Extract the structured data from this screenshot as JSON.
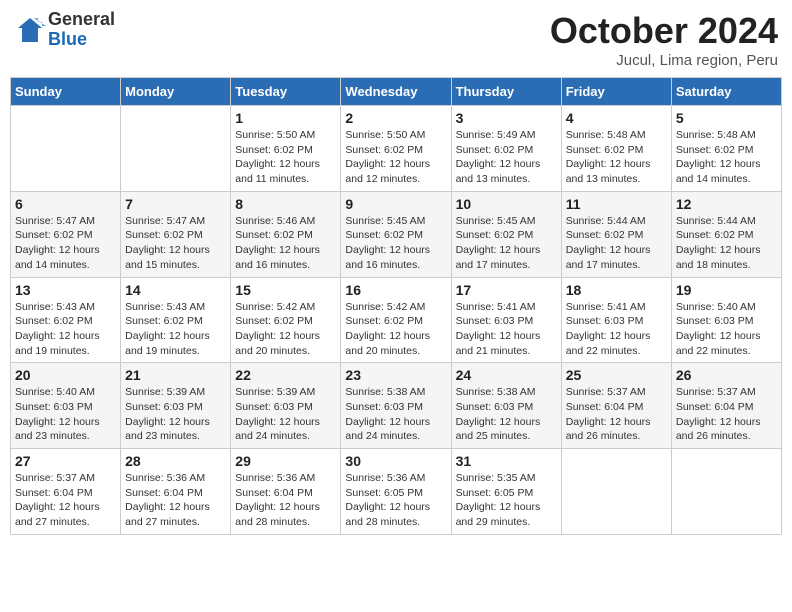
{
  "header": {
    "logo_general": "General",
    "logo_blue": "Blue",
    "month_title": "October 2024",
    "location": "Jucul, Lima region, Peru"
  },
  "weekdays": [
    "Sunday",
    "Monday",
    "Tuesday",
    "Wednesday",
    "Thursday",
    "Friday",
    "Saturday"
  ],
  "weeks": [
    [
      {
        "day": "",
        "sunrise": "",
        "sunset": "",
        "daylight": ""
      },
      {
        "day": "",
        "sunrise": "",
        "sunset": "",
        "daylight": ""
      },
      {
        "day": "1",
        "sunrise": "Sunrise: 5:50 AM",
        "sunset": "Sunset: 6:02 PM",
        "daylight": "Daylight: 12 hours and 11 minutes."
      },
      {
        "day": "2",
        "sunrise": "Sunrise: 5:50 AM",
        "sunset": "Sunset: 6:02 PM",
        "daylight": "Daylight: 12 hours and 12 minutes."
      },
      {
        "day": "3",
        "sunrise": "Sunrise: 5:49 AM",
        "sunset": "Sunset: 6:02 PM",
        "daylight": "Daylight: 12 hours and 13 minutes."
      },
      {
        "day": "4",
        "sunrise": "Sunrise: 5:48 AM",
        "sunset": "Sunset: 6:02 PM",
        "daylight": "Daylight: 12 hours and 13 minutes."
      },
      {
        "day": "5",
        "sunrise": "Sunrise: 5:48 AM",
        "sunset": "Sunset: 6:02 PM",
        "daylight": "Daylight: 12 hours and 14 minutes."
      }
    ],
    [
      {
        "day": "6",
        "sunrise": "Sunrise: 5:47 AM",
        "sunset": "Sunset: 6:02 PM",
        "daylight": "Daylight: 12 hours and 14 minutes."
      },
      {
        "day": "7",
        "sunrise": "Sunrise: 5:47 AM",
        "sunset": "Sunset: 6:02 PM",
        "daylight": "Daylight: 12 hours and 15 minutes."
      },
      {
        "day": "8",
        "sunrise": "Sunrise: 5:46 AM",
        "sunset": "Sunset: 6:02 PM",
        "daylight": "Daylight: 12 hours and 16 minutes."
      },
      {
        "day": "9",
        "sunrise": "Sunrise: 5:45 AM",
        "sunset": "Sunset: 6:02 PM",
        "daylight": "Daylight: 12 hours and 16 minutes."
      },
      {
        "day": "10",
        "sunrise": "Sunrise: 5:45 AM",
        "sunset": "Sunset: 6:02 PM",
        "daylight": "Daylight: 12 hours and 17 minutes."
      },
      {
        "day": "11",
        "sunrise": "Sunrise: 5:44 AM",
        "sunset": "Sunset: 6:02 PM",
        "daylight": "Daylight: 12 hours and 17 minutes."
      },
      {
        "day": "12",
        "sunrise": "Sunrise: 5:44 AM",
        "sunset": "Sunset: 6:02 PM",
        "daylight": "Daylight: 12 hours and 18 minutes."
      }
    ],
    [
      {
        "day": "13",
        "sunrise": "Sunrise: 5:43 AM",
        "sunset": "Sunset: 6:02 PM",
        "daylight": "Daylight: 12 hours and 19 minutes."
      },
      {
        "day": "14",
        "sunrise": "Sunrise: 5:43 AM",
        "sunset": "Sunset: 6:02 PM",
        "daylight": "Daylight: 12 hours and 19 minutes."
      },
      {
        "day": "15",
        "sunrise": "Sunrise: 5:42 AM",
        "sunset": "Sunset: 6:02 PM",
        "daylight": "Daylight: 12 hours and 20 minutes."
      },
      {
        "day": "16",
        "sunrise": "Sunrise: 5:42 AM",
        "sunset": "Sunset: 6:02 PM",
        "daylight": "Daylight: 12 hours and 20 minutes."
      },
      {
        "day": "17",
        "sunrise": "Sunrise: 5:41 AM",
        "sunset": "Sunset: 6:03 PM",
        "daylight": "Daylight: 12 hours and 21 minutes."
      },
      {
        "day": "18",
        "sunrise": "Sunrise: 5:41 AM",
        "sunset": "Sunset: 6:03 PM",
        "daylight": "Daylight: 12 hours and 22 minutes."
      },
      {
        "day": "19",
        "sunrise": "Sunrise: 5:40 AM",
        "sunset": "Sunset: 6:03 PM",
        "daylight": "Daylight: 12 hours and 22 minutes."
      }
    ],
    [
      {
        "day": "20",
        "sunrise": "Sunrise: 5:40 AM",
        "sunset": "Sunset: 6:03 PM",
        "daylight": "Daylight: 12 hours and 23 minutes."
      },
      {
        "day": "21",
        "sunrise": "Sunrise: 5:39 AM",
        "sunset": "Sunset: 6:03 PM",
        "daylight": "Daylight: 12 hours and 23 minutes."
      },
      {
        "day": "22",
        "sunrise": "Sunrise: 5:39 AM",
        "sunset": "Sunset: 6:03 PM",
        "daylight": "Daylight: 12 hours and 24 minutes."
      },
      {
        "day": "23",
        "sunrise": "Sunrise: 5:38 AM",
        "sunset": "Sunset: 6:03 PM",
        "daylight": "Daylight: 12 hours and 24 minutes."
      },
      {
        "day": "24",
        "sunrise": "Sunrise: 5:38 AM",
        "sunset": "Sunset: 6:03 PM",
        "daylight": "Daylight: 12 hours and 25 minutes."
      },
      {
        "day": "25",
        "sunrise": "Sunrise: 5:37 AM",
        "sunset": "Sunset: 6:04 PM",
        "daylight": "Daylight: 12 hours and 26 minutes."
      },
      {
        "day": "26",
        "sunrise": "Sunrise: 5:37 AM",
        "sunset": "Sunset: 6:04 PM",
        "daylight": "Daylight: 12 hours and 26 minutes."
      }
    ],
    [
      {
        "day": "27",
        "sunrise": "Sunrise: 5:37 AM",
        "sunset": "Sunset: 6:04 PM",
        "daylight": "Daylight: 12 hours and 27 minutes."
      },
      {
        "day": "28",
        "sunrise": "Sunrise: 5:36 AM",
        "sunset": "Sunset: 6:04 PM",
        "daylight": "Daylight: 12 hours and 27 minutes."
      },
      {
        "day": "29",
        "sunrise": "Sunrise: 5:36 AM",
        "sunset": "Sunset: 6:04 PM",
        "daylight": "Daylight: 12 hours and 28 minutes."
      },
      {
        "day": "30",
        "sunrise": "Sunrise: 5:36 AM",
        "sunset": "Sunset: 6:05 PM",
        "daylight": "Daylight: 12 hours and 28 minutes."
      },
      {
        "day": "31",
        "sunrise": "Sunrise: 5:35 AM",
        "sunset": "Sunset: 6:05 PM",
        "daylight": "Daylight: 12 hours and 29 minutes."
      },
      {
        "day": "",
        "sunrise": "",
        "sunset": "",
        "daylight": ""
      },
      {
        "day": "",
        "sunrise": "",
        "sunset": "",
        "daylight": ""
      }
    ]
  ]
}
